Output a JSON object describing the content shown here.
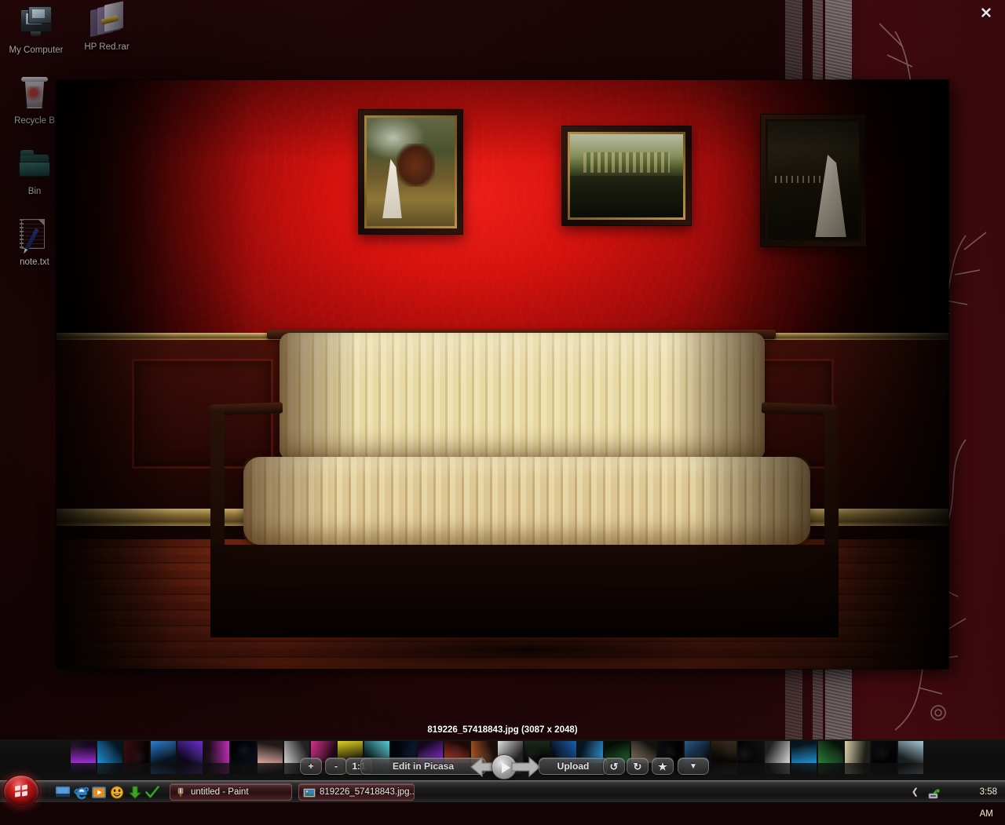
{
  "desktop": {
    "icons": [
      {
        "label": "My Computer",
        "icon": "my-computer-icon"
      },
      {
        "label": "HP Red.rar",
        "icon": "rar-archive-icon"
      },
      {
        "label": "Recycle B",
        "icon": "recycle-bin-icon"
      },
      {
        "label": "Bin",
        "icon": "folder-icon"
      },
      {
        "label": "note.txt",
        "icon": "text-note-icon"
      }
    ],
    "wallpaper_colors": {
      "base": "#1b0405",
      "accent_red": "#8e0c0a",
      "ornament_gray": "#8a8a8a"
    }
  },
  "viewer": {
    "close_label": "✕",
    "caption": "819226_57418843.jpg (3087 x 2048)",
    "photo": {
      "alt": "Cream striped sofa against red wall with three framed wedding photographs",
      "dimensions": "3087 x 2048"
    }
  },
  "toolbar": {
    "zoom_in_label": "+",
    "zoom_out_label": "-",
    "actual_size_label": "1:1",
    "edit_label": "Edit in Picasa",
    "prev_label": "prev-arrow",
    "play_label": "play",
    "next_label": "next-arrow",
    "upload_label": "Upload",
    "rotate_ccw_label": "↺",
    "rotate_cw_label": "↻",
    "star_label": "★",
    "more_label": "▼"
  },
  "filmstrip": {
    "thumbnails": [
      "#9b2fd0",
      "#1f8fd8",
      "#3b0d12",
      "#2a7fd4",
      "#6a2fd0",
      "#c02fb4",
      "#0a0d1c",
      "#d8a8a0",
      "#d0d0d0",
      "#d8308c",
      "#e0d020",
      "#55ccd8",
      "#0a1830",
      "#8e2fd8",
      "#c03a2a",
      "#b85a2a",
      "#e0e0e0",
      "#1a2a1a",
      "#1b5fb0",
      "#2a8fd8",
      "#1e5e2a",
      "#8b7a60",
      "#0d0d0d",
      "#2a5a8a",
      "#3a2a1a",
      "#101010",
      "#d8d8d8",
      "#1f8fd0",
      "#2a7f3a",
      "#d8cfa8",
      "#0c0c0c",
      "#a8c8d8"
    ]
  },
  "taskbar": {
    "start_label": "Start",
    "quick_launch": [
      {
        "name": "show-desktop-icon",
        "color": "#2f6ea8"
      },
      {
        "name": "internet-explorer-icon",
        "color": "#1b6fb3"
      },
      {
        "name": "media-player-icon",
        "color": "#e08a1a"
      },
      {
        "name": "messenger-icon",
        "color": "#e8b22a"
      },
      {
        "name": "download-arrow-icon",
        "color": "#3fa02a"
      },
      {
        "name": "checkmark-icon",
        "color": "#2fa02a"
      }
    ],
    "windows": [
      {
        "title": "untitled - Paint",
        "icon": "paint-icon",
        "active": false
      },
      {
        "title": "819226_57418843.jpg...",
        "icon": "photo-icon",
        "active": true
      }
    ],
    "tray": {
      "chevron": "❮",
      "network_icon": "network-icon",
      "clock": "3:58 AM"
    }
  }
}
